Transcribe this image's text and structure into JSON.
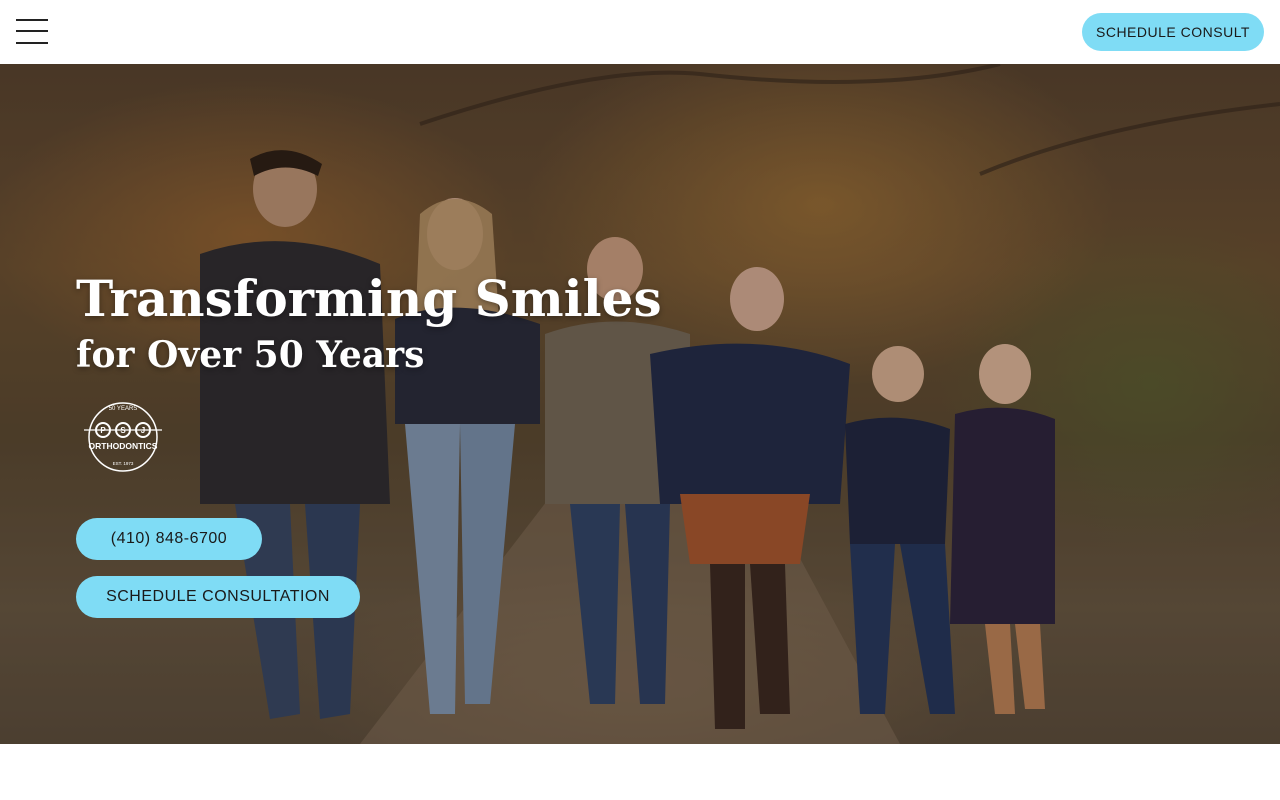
{
  "header": {
    "menu_icon": "hamburger-menu-icon",
    "cta_label": "SCHEDULE CONSULT"
  },
  "hero": {
    "title": "Transforming Smiles",
    "subtitle": "for Over 50 Years",
    "badge": {
      "top_text": "50 YEARS",
      "letters": [
        "P",
        "S",
        "J"
      ],
      "name": "ORTHODONTICS",
      "bottom_text": "EST. 1973"
    },
    "phone_label": "(410) 848-6700",
    "consult_label": "SCHEDULE CONSULTATION"
  },
  "colors": {
    "accent": "#7fdcf5",
    "header_bg": "#ffffff",
    "hero_text": "#ffffff"
  }
}
